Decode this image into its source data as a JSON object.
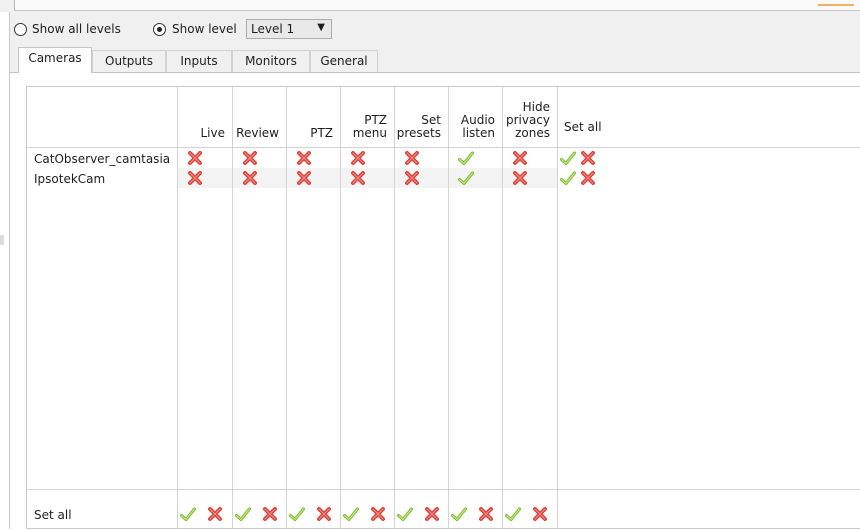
{
  "level_filter": {
    "show_all_label": "Show all levels",
    "show_level_label": "Show level",
    "selected": "show_level",
    "level_value": "Level 1",
    "dropdown_arrow": "▼"
  },
  "tabs": [
    {
      "label": "Cameras",
      "active": true
    },
    {
      "label": "Outputs",
      "active": false
    },
    {
      "label": "Inputs",
      "active": false
    },
    {
      "label": "Monitors",
      "active": false
    },
    {
      "label": "General",
      "active": false
    }
  ],
  "table": {
    "columns": [
      {
        "lines": [
          "Live"
        ]
      },
      {
        "lines": [
          "Review"
        ]
      },
      {
        "lines": [
          "PTZ"
        ]
      },
      {
        "lines": [
          "PTZ",
          "menu"
        ]
      },
      {
        "lines": [
          "Set",
          "presets"
        ]
      },
      {
        "lines": [
          "Audio",
          "listen"
        ]
      },
      {
        "lines": [
          "Hide",
          "privacy",
          "zones"
        ]
      }
    ],
    "set_all_column_label": "Set all",
    "rows": [
      {
        "name": "CatObserver_camtasia",
        "perms": [
          "deny",
          "deny",
          "deny",
          "deny",
          "deny",
          "allow",
          "deny"
        ]
      },
      {
        "name": "IpsotekCam",
        "perms": [
          "deny",
          "deny",
          "deny",
          "deny",
          "deny",
          "allow",
          "deny"
        ]
      }
    ],
    "set_all_row_label": "Set all"
  },
  "colors": {
    "allow": "#7bbd2a",
    "deny": "#d8453d"
  }
}
